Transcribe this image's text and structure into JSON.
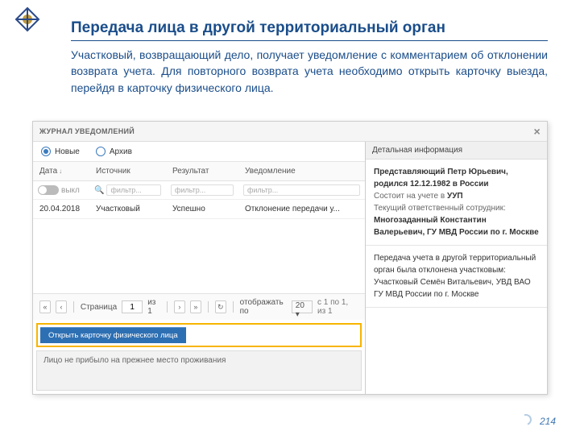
{
  "slide": {
    "title": "Передача лица в другой территориальный орган",
    "intro": "Участковый, возвращающий дело, получает уведомление с комментарием об отклонении возврата учета. Для повторного возврата учета необходимо открыть карточку выезда, перейдя в карточку физического лица.",
    "page": "214"
  },
  "app": {
    "headerTitle": "ЖУРНАЛ УВЕДОМЛЕНИЙ",
    "radios": {
      "new": "Новые",
      "archive": "Архив"
    },
    "columns": {
      "date": "Дата",
      "source": "Источник",
      "result": "Результат",
      "notice": "Уведомление"
    },
    "filter": {
      "toggle": "выкл",
      "placeholder": "фильтр..."
    },
    "row": {
      "date": "20.04.2018",
      "source": "Участковый",
      "result": "Успешно",
      "notice": "Отклонение передачи у..."
    },
    "pager": {
      "pageLabel": "Страница",
      "page": "1",
      "ofPages": "из 1",
      "perPageLabel": "отображать по",
      "perPage": "20",
      "range": "с 1 по 1, из 1"
    },
    "openBtn": "Открыть карточку физического лица",
    "note": "Лицо не прибыло на прежнее место проживания"
  },
  "detail": {
    "header": "Детальная информация",
    "personLabel": "Представляющий",
    "personName": "Петр Юрьевич, родился 12.12.1982 в России",
    "statusLabel": "Состоит на учете в",
    "statusValue": "УУП",
    "respLabel": "Текущий ответственный сотрудник:",
    "respValue": "Многозаданный Константин Валерьевич, ГУ МВД России по г. Москве",
    "msg": "Передача учета в другой территориальный орган была отклонена участковым: Участковый Семён Витальевич, УВД ВАО ГУ МВД России по г. Москве"
  }
}
